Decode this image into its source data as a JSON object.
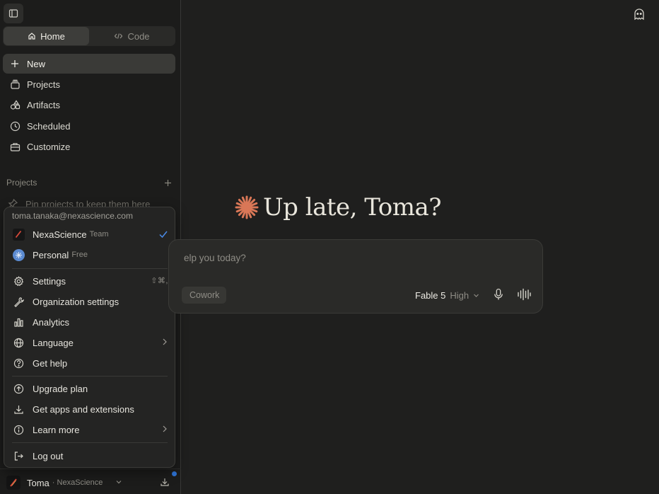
{
  "sidebar": {
    "modes": [
      {
        "label": "Home",
        "active": true
      },
      {
        "label": "Code",
        "active": false
      }
    ],
    "nav": [
      {
        "label": "New",
        "icon": "plus-icon",
        "active": true
      },
      {
        "label": "Projects",
        "icon": "projects-icon"
      },
      {
        "label": "Artifacts",
        "icon": "artifacts-icon"
      },
      {
        "label": "Scheduled",
        "icon": "clock-icon"
      },
      {
        "label": "Customize",
        "icon": "briefcase-icon"
      }
    ],
    "projects_heading": "Projects",
    "pin_hint": "Pin projects to keep them here",
    "account": {
      "name": "Toma",
      "org": "· NexaScience"
    }
  },
  "menu": {
    "email": "toma.tanaka@nexascience.com",
    "orgs": [
      {
        "name": "NexaScience",
        "plan": "Team",
        "selected": true
      },
      {
        "name": "Personal",
        "plan": "Free",
        "selected": false
      }
    ],
    "items_a": [
      {
        "label": "Settings",
        "icon": "gear-icon",
        "shortcut": "⇧⌘,"
      },
      {
        "label": "Organization settings",
        "icon": "wrench-icon"
      },
      {
        "label": "Analytics",
        "icon": "bar-chart-icon"
      },
      {
        "label": "Language",
        "icon": "globe-icon",
        "submenu": true
      },
      {
        "label": "Get help",
        "icon": "help-circle-icon"
      }
    ],
    "items_b": [
      {
        "label": "Upgrade plan",
        "icon": "upgrade-icon"
      },
      {
        "label": "Get apps and extensions",
        "icon": "download-icon"
      },
      {
        "label": "Learn more",
        "icon": "info-icon",
        "submenu": true
      }
    ],
    "logout_label": "Log out"
  },
  "main": {
    "greeting": "Up late, Toma?",
    "composer_placeholder": "elp you today?",
    "cowork_label": "Cowork",
    "model_name": "Fable 5",
    "model_effort": "High"
  },
  "colors": {
    "accent": "#d97757",
    "notification": "#2f74d6",
    "check": "#4a8be8"
  }
}
